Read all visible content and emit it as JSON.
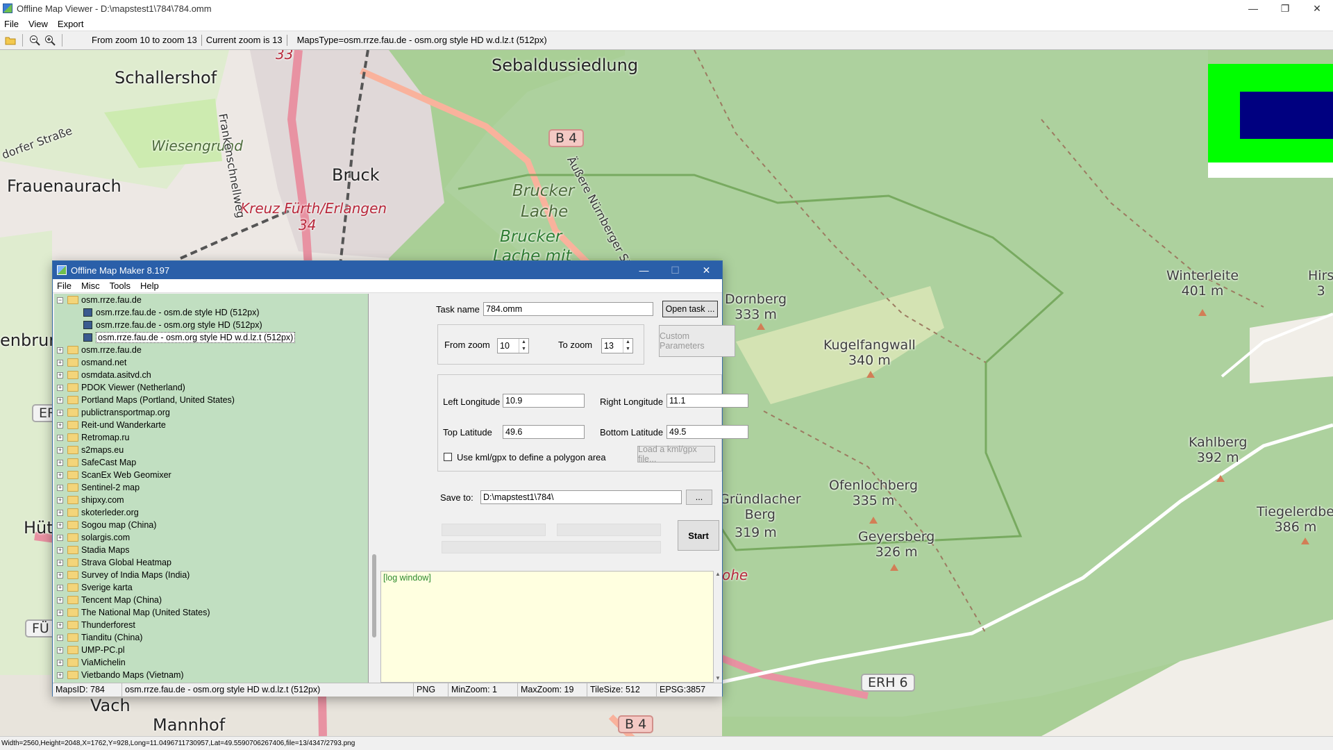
{
  "window": {
    "title": "Offline Map Viewer - D:\\mapstest1\\784\\784.omm",
    "controls": {
      "minimize": "—",
      "restore": "❐",
      "close": "✕"
    }
  },
  "menu": [
    "File",
    "View",
    "Export"
  ],
  "toolbar": {
    "zoom_range": "From zoom 10 to zoom 13",
    "current_zoom": "Current zoom is 13",
    "maps_type": "MapsType=osm.rrze.fau.de - osm.org style HD w.d.lz.t (512px)"
  },
  "map": {
    "towns": [
      "Schallershof",
      "Sebaldussiedlung",
      "Frauenaurach",
      "Bruck",
      "enbrun",
      "Hüt",
      "Vach",
      "Mannhof"
    ],
    "italic_labels": [
      "Wiesengrund",
      "Brucker",
      "Lache",
      "Brucker",
      "Lache mit"
    ],
    "red_labels": [
      "Kreuz Fürth/Erlangen",
      "34",
      "33",
      "ohe"
    ],
    "streets": [
      "dorfer Straße",
      "Frankenschnellweg",
      "Äußere Nürnberger Str"
    ],
    "hills": [
      {
        "name": "Dornberg",
        "height": "333 m"
      },
      {
        "name": "Kugelfangwall",
        "height": "340 m"
      },
      {
        "name": "Winterleite",
        "height": "401 m"
      },
      {
        "name": "Hirs",
        "height": "3"
      },
      {
        "name": "Ofenlochberg",
        "height": "335 m"
      },
      {
        "name": "Geyersberg",
        "height": "326 m"
      },
      {
        "name": "Gründlacher",
        "height": "Berg"
      },
      {
        "name": "",
        "height": "319 m"
      },
      {
        "name": "Kahlberg",
        "height": "392 m"
      },
      {
        "name": "Tiegelerdbe",
        "height": "386 m"
      }
    ],
    "shields": [
      "B 4",
      "ERH 6",
      "B 4",
      "ER",
      "FÜ"
    ]
  },
  "dialog": {
    "title": "Offline Map Maker 8.197",
    "controls": {
      "minimize": "—",
      "maximize": "☐",
      "close": "✕"
    },
    "menu": [
      "File",
      "Misc",
      "Tools",
      "Help"
    ],
    "tree": {
      "root": "osm.rrze.fau.de",
      "children": [
        "osm.rrze.fau.de - osm.de style HD (512px)",
        "osm.rrze.fau.de - osm.org style HD (512px)",
        "osm.rrze.fau.de - osm.org style HD w.d.lz.t (512px)"
      ],
      "folders": [
        "osm.rrze.fau.de",
        "osmand.net",
        "osmdata.asitvd.ch",
        "PDOK Viewer (Netherland)",
        "Portland Maps (Portland, United States)",
        "publictransportmap.org",
        "Reit-und Wanderkarte",
        "Retromap.ru",
        "s2maps.eu",
        "SafeCast Map",
        "ScanEx Web Geomixer",
        "Sentinel-2 map",
        "shipxy.com",
        "skoterleder.org",
        "Sogou map (China)",
        "solargis.com",
        "Stadia Maps",
        "Strava Global Heatmap",
        "Survey of India Maps (India)",
        "Sverige karta",
        "Tencent Map (China)",
        "The National Map (United States)",
        "Thunderforest",
        "Tianditu (China)",
        "UMP-PC.pl",
        "ViaMichelin",
        "Vietbando Maps (Vietnam)"
      ]
    },
    "form": {
      "task_name_label": "Task name",
      "task_name_value": "784.omm",
      "open_task": "Open task ...",
      "from_zoom_label": "From zoom",
      "from_zoom_value": "10",
      "to_zoom_label": "To zoom",
      "to_zoom_value": "13",
      "custom_params": "Custom Parameters",
      "left_lon_label": "Left Longitude",
      "left_lon_value": "10.9",
      "right_lon_label": "Right Longitude",
      "right_lon_value": "11.1",
      "top_lat_label": "Top Latitude",
      "top_lat_value": "49.6",
      "bottom_lat_label": "Bottom Latitude",
      "bottom_lat_value": "49.5",
      "kml_check_label": "Use kml/gpx to define a polygon area",
      "load_kml": "Load a kml/gpx file...",
      "save_to_label": "Save to:",
      "save_to_value": "D:\\mapstest1\\784\\",
      "browse": "...",
      "start": "Start"
    },
    "log_text": "[log window]",
    "status": {
      "maps_id": "MapsID: 784",
      "maps_name": "osm.rrze.fau.de - osm.org style HD w.d.lz.t (512px)",
      "format": "PNG",
      "min_zoom": "MinZoom: 1",
      "max_zoom": "MaxZoom: 19",
      "tile_size": "TileSize: 512",
      "epsg": "EPSG:3857"
    }
  },
  "statusbar": "Width=2560,Height=2048,X=1762,Y=928,Long=11.0496711730957,Lat=49.5590706267406,file=13/4347/2793.png",
  "colors": {
    "forest": "#a9cf96",
    "urban": "#e0d8d8",
    "motorway": "#e892a2",
    "trunk": "#f9b29c",
    "dialog_title": "#2a5fa9",
    "tree_bg": "#c1dfc1",
    "log_bg": "#ffffe0"
  }
}
